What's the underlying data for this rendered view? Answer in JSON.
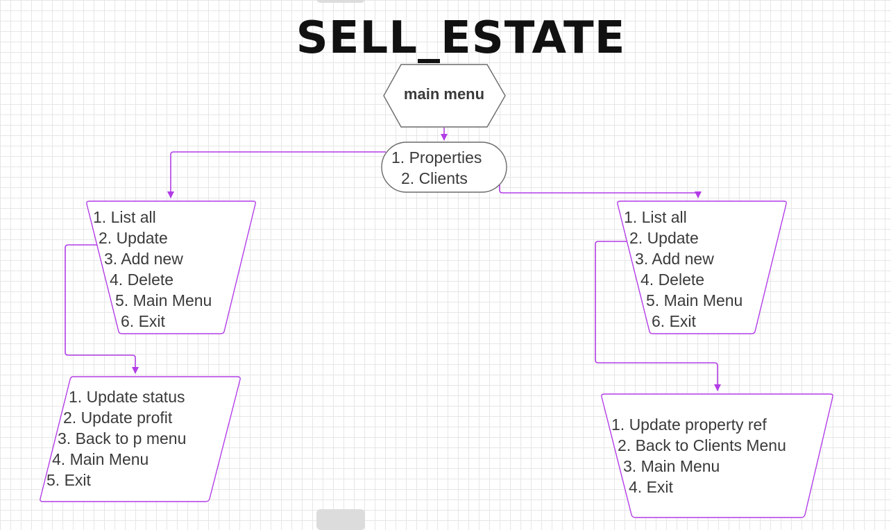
{
  "title": "SELL_ESTATE",
  "colors": {
    "connector": "#b23ce6",
    "shape_stroke": "#b23ce6",
    "text": "#3a3a3a"
  },
  "main_menu": {
    "label": "main menu"
  },
  "top_choice": {
    "items": [
      "1.  Properties",
      "2.  Clients"
    ]
  },
  "properties_menu": {
    "items": [
      "1. List all",
      "2. Update",
      "3. Add new",
      "4. Delete",
      "5. Main Menu",
      "6. Exit"
    ]
  },
  "clients_menu": {
    "items": [
      "1. List all",
      "2. Update",
      "3. Add new",
      "4. Delete",
      "5. Main Menu",
      "6. Exit"
    ]
  },
  "property_update_menu": {
    "items": [
      "1.  Update status",
      "2. Update profit",
      "3.  Back to p menu",
      "4. Main Menu",
      "5. Exit"
    ]
  },
  "client_update_menu": {
    "items": [
      "1. Update property ref",
      "2. Back to Clients Menu",
      "3.  Main Menu",
      "4.  Exit"
    ]
  }
}
